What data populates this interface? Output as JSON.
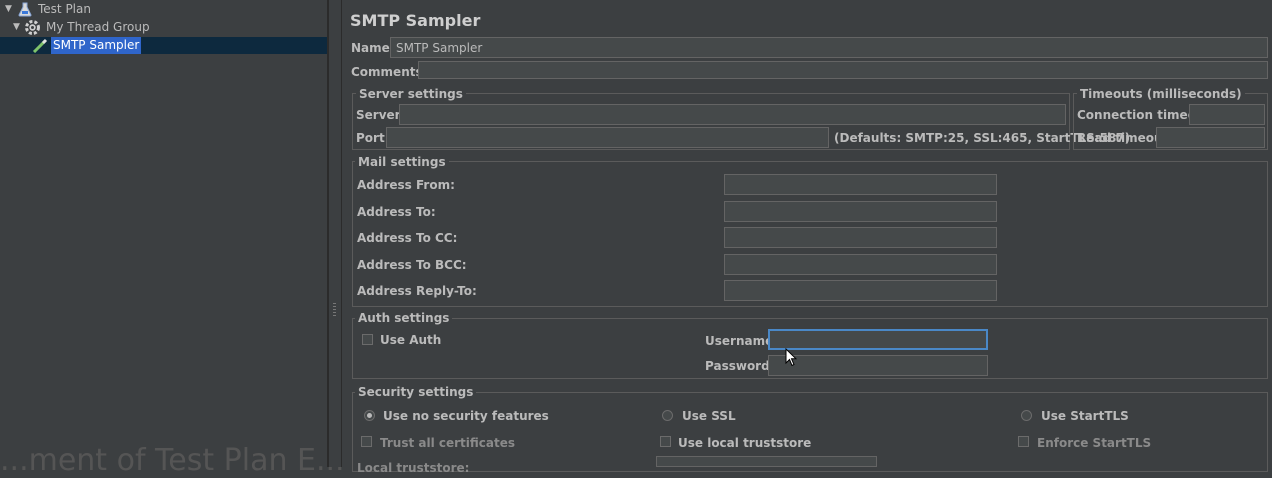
{
  "tree": {
    "test_plan": "Test Plan",
    "thread_group": "My Thread Group",
    "sampler": "SMTP Sampler",
    "watermark": "...ment of Test Plan E..."
  },
  "panel": {
    "title": "SMTP Sampler",
    "name_label": "Name:",
    "name_value": "SMTP Sampler",
    "comments_label": "Comments:"
  },
  "server": {
    "legend": "Server settings",
    "server_label": "Server:",
    "server_value": "",
    "port_label": "Port:",
    "port_value": "",
    "defaults": "(Defaults: SMTP:25, SSL:465, StartTLS:587)"
  },
  "timeouts": {
    "legend": "Timeouts (milliseconds)",
    "connection_label": "Connection timeout:",
    "connection_value": "",
    "read_label": "Read timeout:",
    "read_value": ""
  },
  "mail": {
    "legend": "Mail settings",
    "from_label": "Address From:",
    "to_label": "Address To:",
    "cc_label": "Address To CC:",
    "bcc_label": "Address To BCC:",
    "reply_label": "Address Reply-To:",
    "from_value": "",
    "to_value": "",
    "cc_value": "",
    "bcc_value": "",
    "reply_value": ""
  },
  "auth": {
    "legend": "Auth settings",
    "use_auth": "Use Auth",
    "use_auth_checked": false,
    "username_label": "Username:",
    "username_value": "",
    "password_label": "Password:",
    "password_value": ""
  },
  "security": {
    "legend": "Security settings",
    "no_security": "Use no security features",
    "use_ssl": "Use SSL",
    "use_starttls": "Use StartTLS",
    "selected": "no_security",
    "trust_all": "Trust all certificates",
    "local_truststore": "Use local truststore",
    "enforce_starttls": "Enforce StartTLS",
    "local_truststore_label": "Local truststore:"
  },
  "colors": {
    "background": "#3c3f41",
    "field": "#45494a",
    "selection": "#2f65ca",
    "focus": "#4a88c7"
  }
}
